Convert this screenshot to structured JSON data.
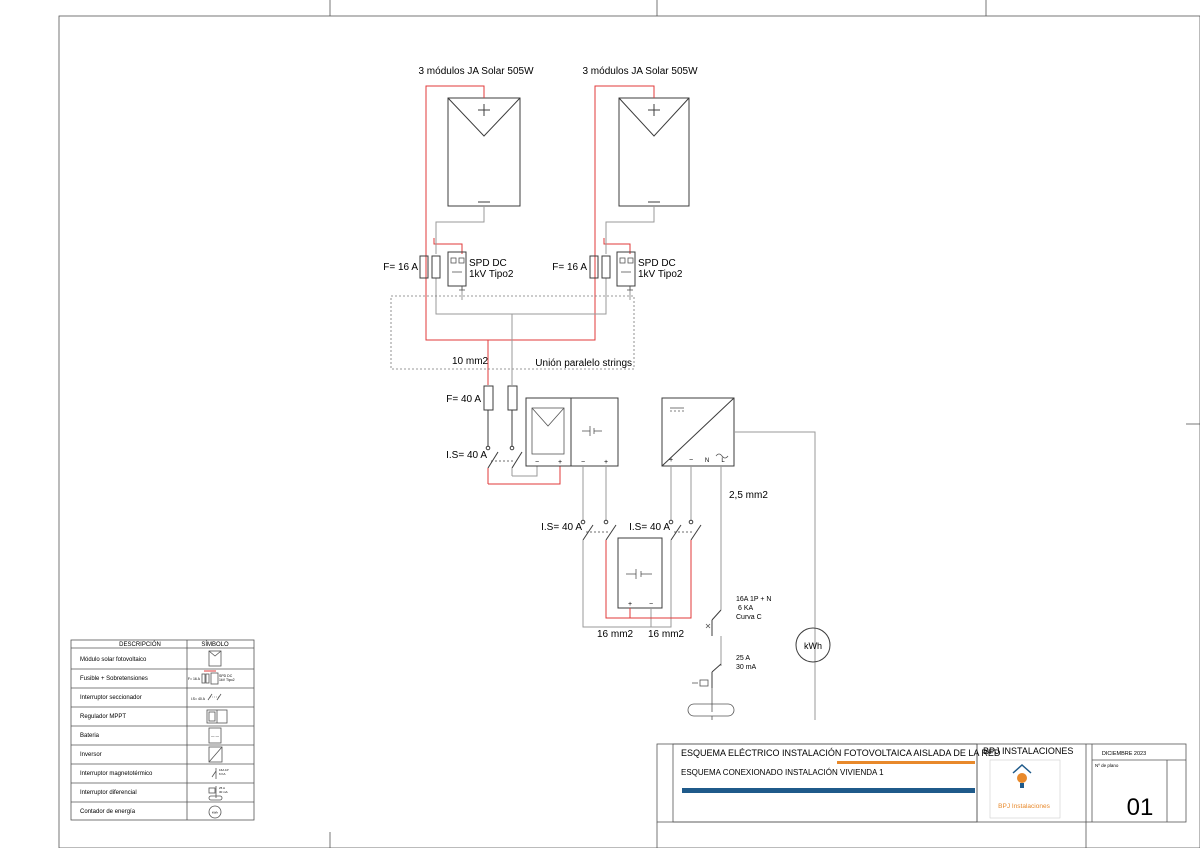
{
  "diagram": {
    "module_labels": [
      "3 módulos JA Solar 505W",
      "3 módulos JA Solar 505W"
    ],
    "fuse_labels": [
      "F= 16 A",
      "F= 16 A"
    ],
    "spd_labels": [
      {
        "line1": "SPD DC",
        "line2": "1kV Tipo2"
      },
      {
        "line1": "SPD DC",
        "line2": "1kV Tipo2"
      }
    ],
    "parallel_box_label": "Unión paralelo strings",
    "cable_10": "10 mm2",
    "fuse_40": "F= 40 A",
    "switch_40_main": "I.S= 40 A",
    "switch_40_left": "I.S= 40 A",
    "switch_40_right": "I.S= 40 A",
    "cable_25": "2,5 mm2",
    "cable_16_left": "16 mm2",
    "cable_16_right": "16 mm2",
    "breaker": {
      "line1": "16A 1P + N",
      "line2": "6 KA",
      "line3": "Curva C"
    },
    "rcd": {
      "line1": "25 A",
      "line2": "30 mA"
    },
    "meter": "kWh",
    "terminal_labels": {
      "plus": "+",
      "minus": "−",
      "n": "N",
      "l": "L"
    }
  },
  "legend": {
    "headers": {
      "description": "DESCRIPCIÓN",
      "symbol": "SÍMBOLO"
    },
    "rows": [
      {
        "label": "Módulo solar fotovoltaico",
        "icon": "solar-module-icon"
      },
      {
        "label": "Fusible + Sobretensiones",
        "icon": "fuse-spd-icon"
      },
      {
        "label": "Interruptor  seccionador",
        "icon": "disconnector-icon"
      },
      {
        "label": "Regulador MPPT",
        "icon": "mppt-icon"
      },
      {
        "label": "Bateria",
        "icon": "battery-icon"
      },
      {
        "label": "Inversor",
        "icon": "inverter-icon"
      },
      {
        "label": "Interruptor magnetotérmico",
        "icon": "breaker-icon"
      },
      {
        "label": "Interruptor diferencial",
        "icon": "rcd-icon"
      },
      {
        "label": "Contador de energía",
        "icon": "meter-icon"
      }
    ],
    "symbol_text": {
      "fuse": "F= 16 A",
      "spd": "SPD DC",
      "spd2": "1kV Tipo2",
      "disconnector": "I.S= 40 A",
      "battery": "— —",
      "breaker1": "16A 1P",
      "breaker2": "6 KA",
      "rcd1": "25 A",
      "rcd2": "30 mA",
      "meter": "kWh"
    }
  },
  "title_block": {
    "title1": "ESQUEMA ELÉCTRICO INSTALACIÓN FOTOVOLTAICA AISLADA DE LA RED",
    "title2": "ESQUEMA CONEXIONADO INSTALACIÓN VIVIENDA 1",
    "company": "BPJ INSTALACIONES",
    "logo_text": "BPJ Instalaciones",
    "date": "DICIEMBRE 2023",
    "plan_label": "Nº de plano",
    "plan_number": "01",
    "colors": {
      "orange": "#e8892b",
      "blue": "#1f5a8a",
      "red_wire": "#e03a3a"
    }
  }
}
